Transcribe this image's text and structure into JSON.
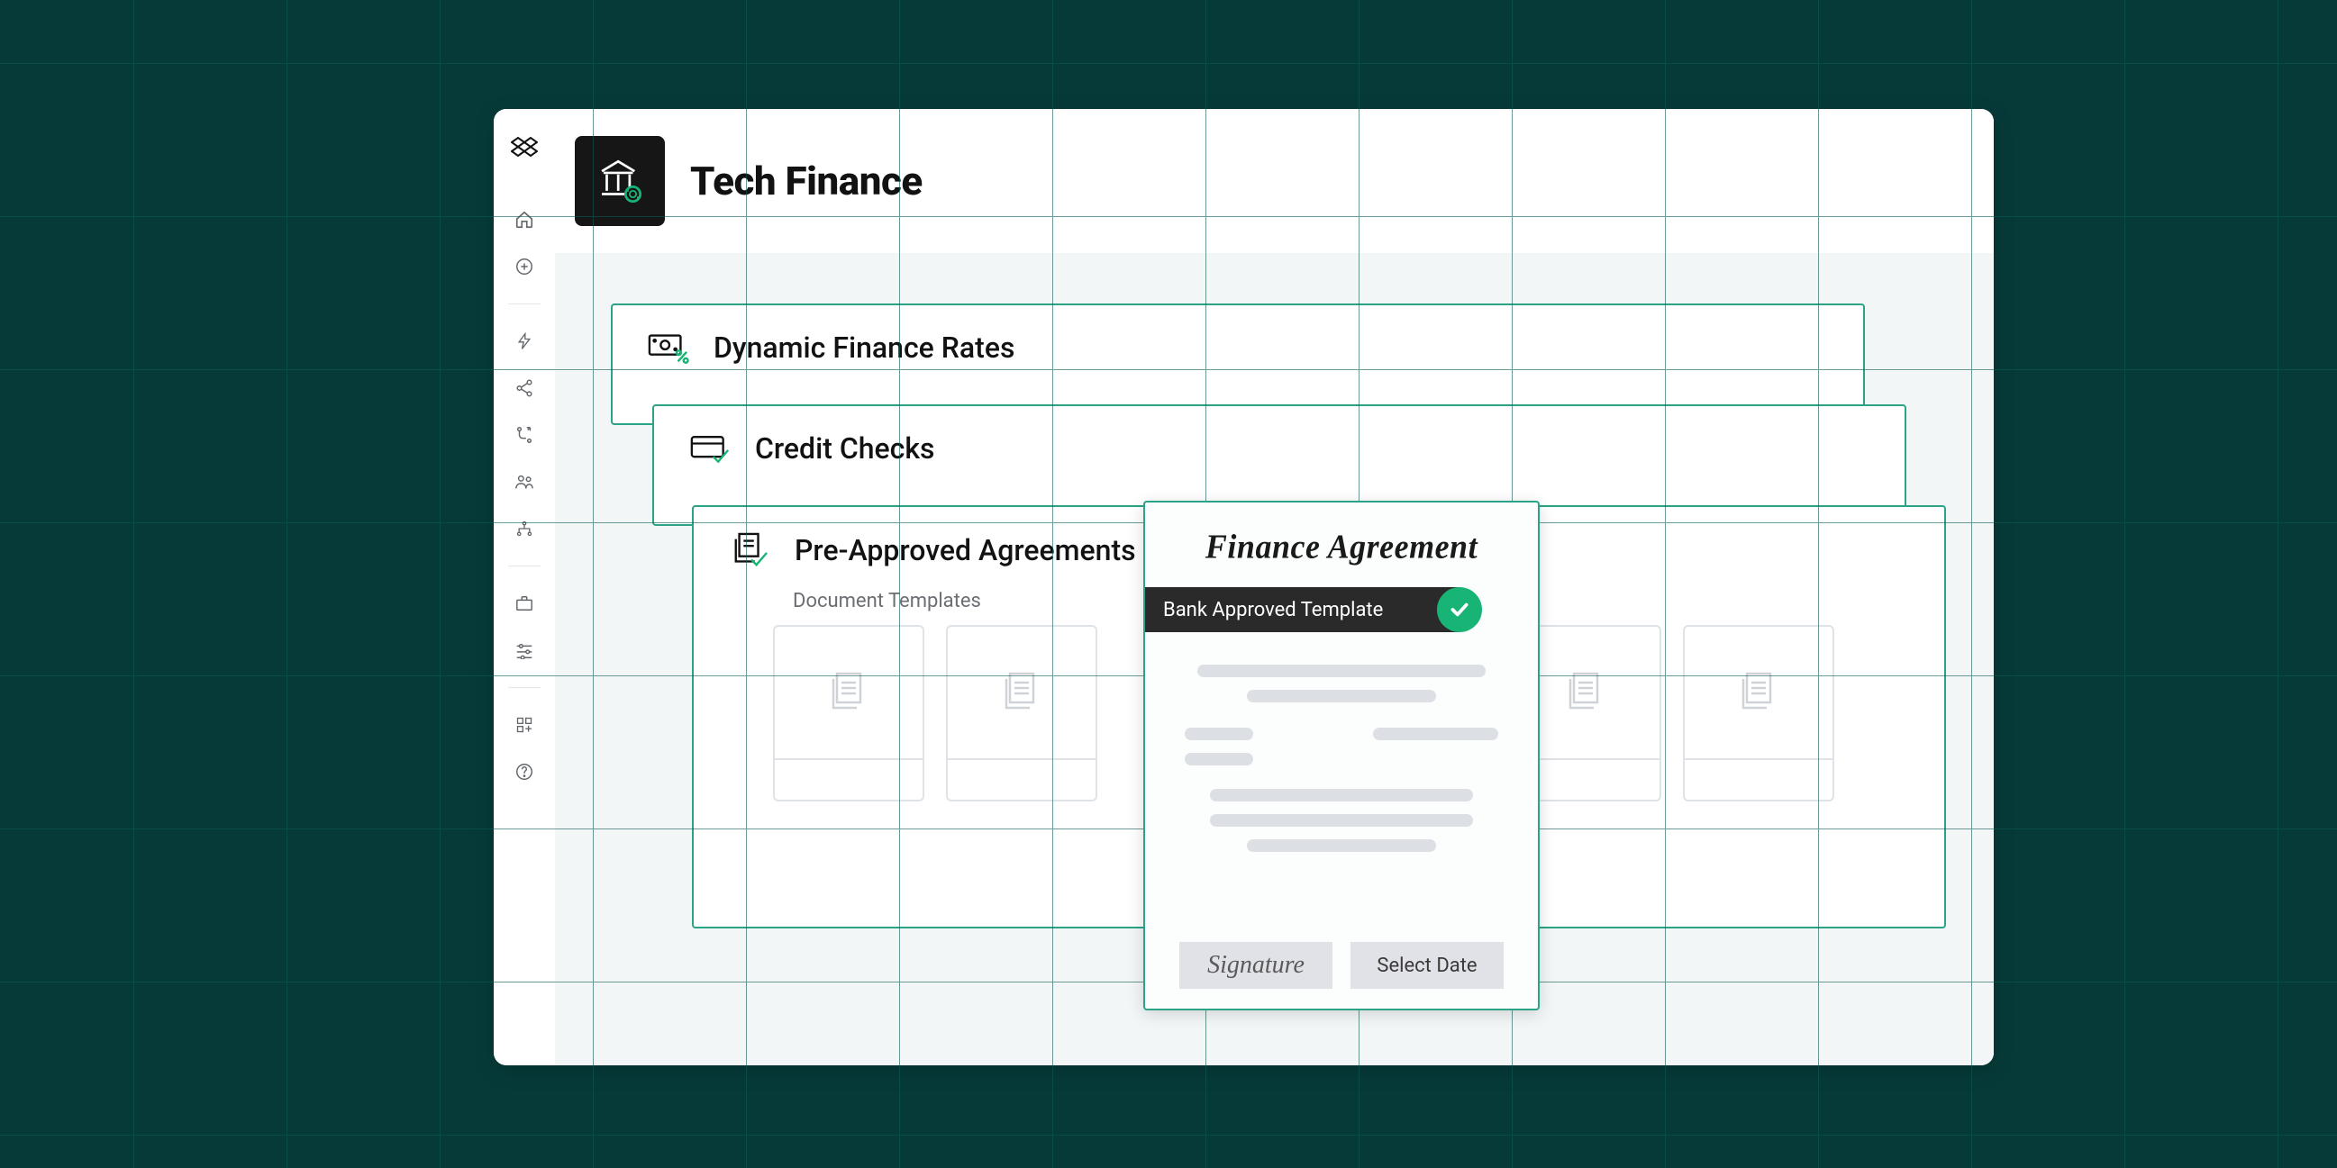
{
  "header": {
    "title": "Tech Finance"
  },
  "cards": [
    {
      "title": "Dynamic Finance Rates"
    },
    {
      "title": "Credit Checks"
    },
    {
      "title": "Pre-Approved Agreements"
    }
  ],
  "templates": {
    "section_label": "Document Templates"
  },
  "doc": {
    "title": "Finance Agreement",
    "badge": "Bank Approved Template",
    "signature_label": "Signature",
    "date_label": "Select Date"
  }
}
